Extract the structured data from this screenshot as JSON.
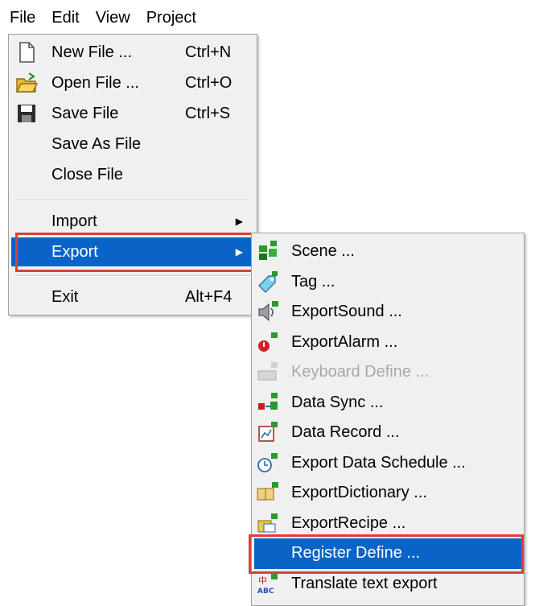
{
  "menubar": {
    "items": [
      "File",
      "Edit",
      "View",
      "Project"
    ]
  },
  "file_menu": {
    "items": [
      {
        "label": "New File ...",
        "shortcut": "Ctrl+N",
        "icon": "new-file-icon"
      },
      {
        "label": "Open File ...",
        "shortcut": "Ctrl+O",
        "icon": "open-file-icon"
      },
      {
        "label": "Save File",
        "shortcut": "Ctrl+S",
        "icon": "save-icon"
      },
      {
        "label": "Save As File",
        "shortcut": ""
      },
      {
        "label": "Close File",
        "shortcut": ""
      },
      {
        "label": "Import",
        "submenu": true
      },
      {
        "label": "Export",
        "submenu": true,
        "highlighted": true
      },
      {
        "label": "Exit",
        "shortcut": "Alt+F4"
      }
    ]
  },
  "export_submenu": {
    "items": [
      {
        "label": "Scene ...",
        "icon": "scene-icon"
      },
      {
        "label": "Tag ...",
        "icon": "tag-icon"
      },
      {
        "label": "ExportSound ...",
        "icon": "sound-icon"
      },
      {
        "label": "ExportAlarm ...",
        "icon": "alarm-icon"
      },
      {
        "label": "Keyboard Define ...",
        "icon": "keyboard-icon",
        "disabled": true
      },
      {
        "label": "Data Sync ...",
        "icon": "data-sync-icon"
      },
      {
        "label": "Data Record ...",
        "icon": "data-record-icon"
      },
      {
        "label": "Export Data Schedule ...",
        "icon": "schedule-icon"
      },
      {
        "label": "ExportDictionary ...",
        "icon": "dictionary-icon"
      },
      {
        "label": "ExportRecipe ...",
        "icon": "recipe-icon"
      },
      {
        "label": "Register Define ...",
        "highlighted": true
      },
      {
        "label": "Translate text export",
        "icon": "translate-icon"
      }
    ]
  },
  "colors": {
    "highlight": "#0a64c8",
    "annotation": "#e03c3c",
    "menu_bg": "#f0f0f0"
  }
}
